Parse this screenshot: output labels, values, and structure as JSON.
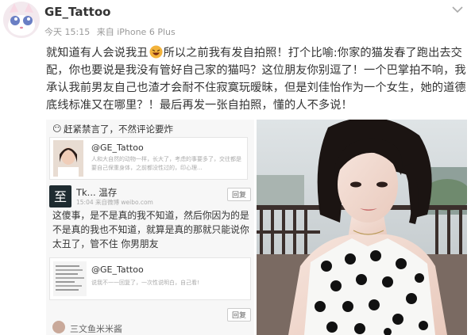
{
  "post": {
    "author": "GE_Tattoo",
    "time": "今天 15:15",
    "source": "来自 iPhone 6 Plus",
    "body_part1": "就知道有人会说我丑",
    "body_part2": "所以之前我有发自拍照！打个比喻:你家的猫发春了跑出去交配，你也要说是我没有管好自己家的猫吗？这位朋友你别逗了！一个巴掌拍不响，我承认我前男友自己也渣才会耐不住寂寞玩暧昧，但是刘佳怡作为一个女生，她的道德底线标准又在哪里？！最后再发一张自拍照，懂的人不多说！"
  },
  "left_image": {
    "banner": "赶紧禁言了，不然评论要炸",
    "quote1": {
      "name": "@GE_Tattoo",
      "text": "人和大自然的动物一样，长大了，考虑的事要多了，交往都是要自己保重身体，之前都没性过的，印心理..."
    },
    "tk": {
      "name": "Tk... 温存",
      "time": "15:04",
      "source": "来自微博 weibo.com",
      "reply": "回复",
      "text": "这傻事，是不是真的我不知道，然后你因为的是不是真的我也不知道，就算是真的那就只能说你太丑了，管不住 你男朋友"
    },
    "quote2": {
      "name": "@GE_Tattoo",
      "text": "说我不一一回复了，一次性说明白，自己看!",
      "reply": "回复"
    },
    "bottom_name": "三文鱼米米酱"
  },
  "colors": {
    "text": "#333333",
    "meta": "#999999",
    "emoji": "#f3b33b"
  }
}
